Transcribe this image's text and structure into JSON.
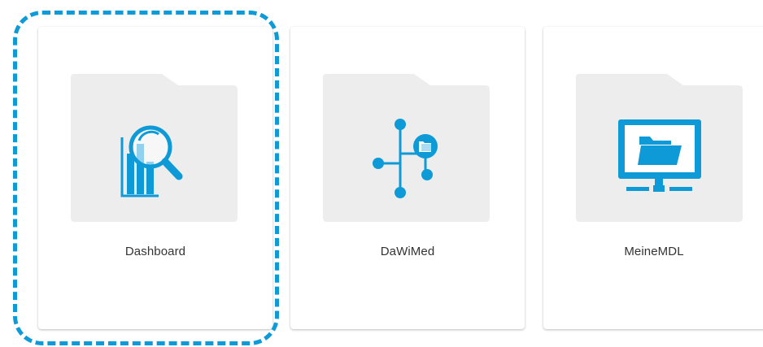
{
  "tiles": [
    {
      "label": "Dashboard",
      "icon": "dashboard-analytics-icon"
    },
    {
      "label": "DaWiMed",
      "icon": "network-folder-icon"
    },
    {
      "label": "MeineMDL",
      "icon": "monitor-folder-icon"
    }
  ],
  "colors": {
    "accent": "#0e9ad7",
    "folder": "#ededed",
    "text": "#333333"
  }
}
